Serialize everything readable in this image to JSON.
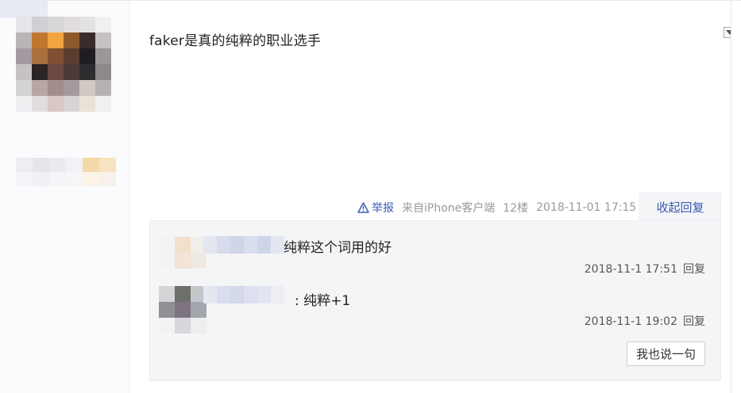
{
  "post": {
    "text": "faker是真的纯粹的职业选手",
    "report_label": "举报",
    "source": "来自iPhone客户端",
    "floor": "12楼",
    "datetime": "2018-11-01 17:15",
    "collapse_label": "收起回复"
  },
  "replies": [
    {
      "text": "纯粹这个词用的好",
      "datetime": "2018-11-1 17:51",
      "reply_label": "回复"
    },
    {
      "text": ": 纯粹+1",
      "datetime": "2018-11-1 19:02",
      "reply_label": "回复"
    }
  ],
  "reply_box": {
    "say_button_label": "我也说一句"
  },
  "icons": {
    "report": "warning-triangle-icon",
    "menu": "dropdown-triangle-icon"
  },
  "colors": {
    "link": "#3b5bb5",
    "meta": "#999999",
    "reply_bg": "#f4f5f7"
  }
}
